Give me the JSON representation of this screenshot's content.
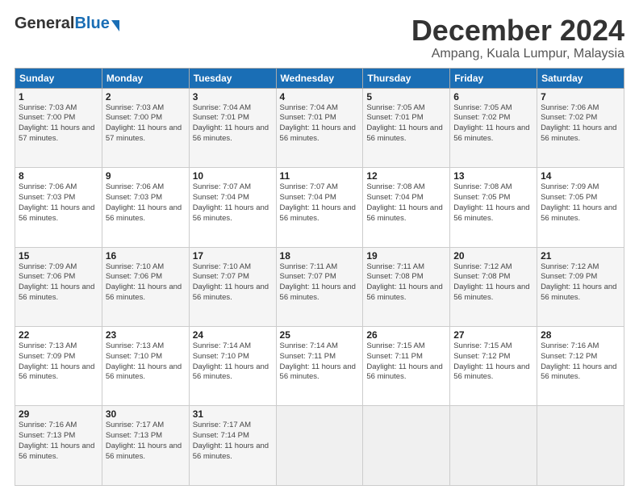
{
  "logo": {
    "part1": "General",
    "part2": "Blue"
  },
  "title": "December 2024",
  "location": "Ampang, Kuala Lumpur, Malaysia",
  "weekdays": [
    "Sunday",
    "Monday",
    "Tuesday",
    "Wednesday",
    "Thursday",
    "Friday",
    "Saturday"
  ],
  "weeks": [
    [
      {
        "day": "1",
        "sunrise": "7:03 AM",
        "sunset": "7:00 PM",
        "daylight": "11 hours and 57 minutes."
      },
      {
        "day": "2",
        "sunrise": "7:03 AM",
        "sunset": "7:00 PM",
        "daylight": "11 hours and 57 minutes."
      },
      {
        "day": "3",
        "sunrise": "7:04 AM",
        "sunset": "7:01 PM",
        "daylight": "11 hours and 56 minutes."
      },
      {
        "day": "4",
        "sunrise": "7:04 AM",
        "sunset": "7:01 PM",
        "daylight": "11 hours and 56 minutes."
      },
      {
        "day": "5",
        "sunrise": "7:05 AM",
        "sunset": "7:01 PM",
        "daylight": "11 hours and 56 minutes."
      },
      {
        "day": "6",
        "sunrise": "7:05 AM",
        "sunset": "7:02 PM",
        "daylight": "11 hours and 56 minutes."
      },
      {
        "day": "7",
        "sunrise": "7:06 AM",
        "sunset": "7:02 PM",
        "daylight": "11 hours and 56 minutes."
      }
    ],
    [
      {
        "day": "8",
        "sunrise": "7:06 AM",
        "sunset": "7:03 PM",
        "daylight": "11 hours and 56 minutes."
      },
      {
        "day": "9",
        "sunrise": "7:06 AM",
        "sunset": "7:03 PM",
        "daylight": "11 hours and 56 minutes."
      },
      {
        "day": "10",
        "sunrise": "7:07 AM",
        "sunset": "7:04 PM",
        "daylight": "11 hours and 56 minutes."
      },
      {
        "day": "11",
        "sunrise": "7:07 AM",
        "sunset": "7:04 PM",
        "daylight": "11 hours and 56 minutes."
      },
      {
        "day": "12",
        "sunrise": "7:08 AM",
        "sunset": "7:04 PM",
        "daylight": "11 hours and 56 minutes."
      },
      {
        "day": "13",
        "sunrise": "7:08 AM",
        "sunset": "7:05 PM",
        "daylight": "11 hours and 56 minutes."
      },
      {
        "day": "14",
        "sunrise": "7:09 AM",
        "sunset": "7:05 PM",
        "daylight": "11 hours and 56 minutes."
      }
    ],
    [
      {
        "day": "15",
        "sunrise": "7:09 AM",
        "sunset": "7:06 PM",
        "daylight": "11 hours and 56 minutes."
      },
      {
        "day": "16",
        "sunrise": "7:10 AM",
        "sunset": "7:06 PM",
        "daylight": "11 hours and 56 minutes."
      },
      {
        "day": "17",
        "sunrise": "7:10 AM",
        "sunset": "7:07 PM",
        "daylight": "11 hours and 56 minutes."
      },
      {
        "day": "18",
        "sunrise": "7:11 AM",
        "sunset": "7:07 PM",
        "daylight": "11 hours and 56 minutes."
      },
      {
        "day": "19",
        "sunrise": "7:11 AM",
        "sunset": "7:08 PM",
        "daylight": "11 hours and 56 minutes."
      },
      {
        "day": "20",
        "sunrise": "7:12 AM",
        "sunset": "7:08 PM",
        "daylight": "11 hours and 56 minutes."
      },
      {
        "day": "21",
        "sunrise": "7:12 AM",
        "sunset": "7:09 PM",
        "daylight": "11 hours and 56 minutes."
      }
    ],
    [
      {
        "day": "22",
        "sunrise": "7:13 AM",
        "sunset": "7:09 PM",
        "daylight": "11 hours and 56 minutes."
      },
      {
        "day": "23",
        "sunrise": "7:13 AM",
        "sunset": "7:10 PM",
        "daylight": "11 hours and 56 minutes."
      },
      {
        "day": "24",
        "sunrise": "7:14 AM",
        "sunset": "7:10 PM",
        "daylight": "11 hours and 56 minutes."
      },
      {
        "day": "25",
        "sunrise": "7:14 AM",
        "sunset": "7:11 PM",
        "daylight": "11 hours and 56 minutes."
      },
      {
        "day": "26",
        "sunrise": "7:15 AM",
        "sunset": "7:11 PM",
        "daylight": "11 hours and 56 minutes."
      },
      {
        "day": "27",
        "sunrise": "7:15 AM",
        "sunset": "7:12 PM",
        "daylight": "11 hours and 56 minutes."
      },
      {
        "day": "28",
        "sunrise": "7:16 AM",
        "sunset": "7:12 PM",
        "daylight": "11 hours and 56 minutes."
      }
    ],
    [
      {
        "day": "29",
        "sunrise": "7:16 AM",
        "sunset": "7:13 PM",
        "daylight": "11 hours and 56 minutes."
      },
      {
        "day": "30",
        "sunrise": "7:17 AM",
        "sunset": "7:13 PM",
        "daylight": "11 hours and 56 minutes."
      },
      {
        "day": "31",
        "sunrise": "7:17 AM",
        "sunset": "7:14 PM",
        "daylight": "11 hours and 56 minutes."
      },
      null,
      null,
      null,
      null
    ]
  ]
}
